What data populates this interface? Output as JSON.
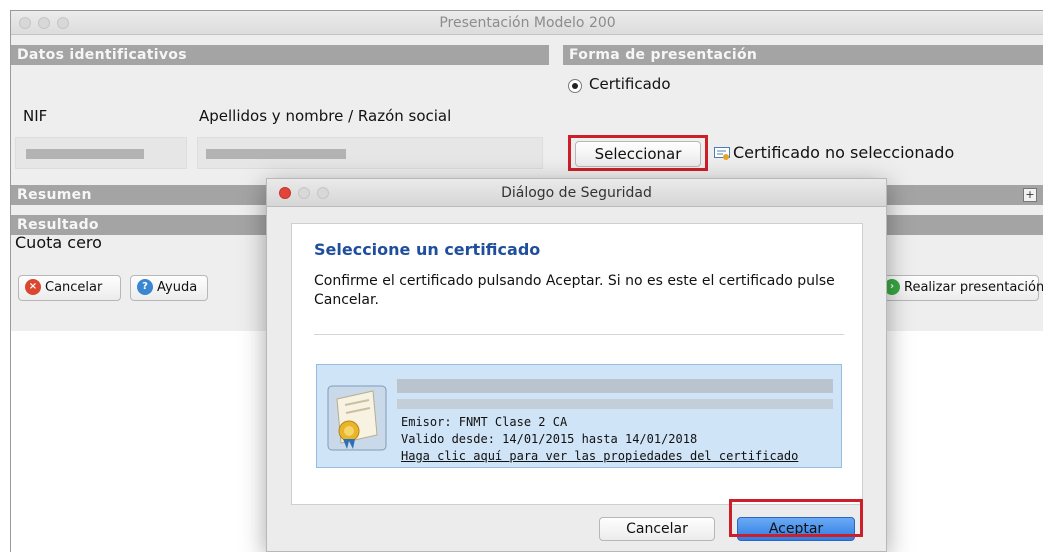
{
  "window": {
    "title": "Presentación Modelo 200"
  },
  "sections": {
    "datos_identificativos": "Datos identificativos",
    "forma_presentacion": "Forma de presentación",
    "resumen": "Resumen",
    "resultado": "Resultado"
  },
  "forma": {
    "radio_label": "Certificado",
    "select_button": "Seleccionar",
    "status": "Certificado no seleccionado"
  },
  "fields": {
    "nif_label": "NIF",
    "nombre_label": "Apellidos y nombre / Razón social"
  },
  "resultado": {
    "value": "Cuota cero"
  },
  "buttons": {
    "cancelar": "Cancelar",
    "ayuda": "Ayuda",
    "realizar": "Realizar presentación"
  },
  "dialog": {
    "title": "Diálogo de Seguridad",
    "heading": "Seleccione un certificado",
    "message": "Confirme el certificado pulsando Aceptar. Si no es este el certificado pulse Cancelar.",
    "cert": {
      "emisor": "Emisor: FNMT Clase 2 CA",
      "validez": "Valido desde: 14/01/2015 hasta 14/01/2018",
      "link": "Haga clic aquí para ver las propiedades del certificado"
    },
    "cancel_button": "Cancelar",
    "accept_button": "Aceptar"
  },
  "colors": {
    "section_header": "#a4a4a4",
    "highlight": "#cc1f2a",
    "heading_blue": "#1f4f9c",
    "accept_blue": "#2f7de3",
    "cancel_red": "#d9472f",
    "help_blue": "#3a86d1",
    "go_green": "#39a845",
    "close_red": "#e0443a"
  }
}
